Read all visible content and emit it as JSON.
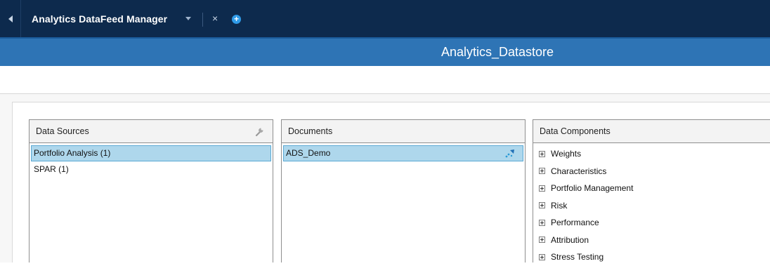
{
  "tab": {
    "title": "Analytics DataFeed Manager",
    "close_glyph": "×",
    "add_glyph": "+"
  },
  "header": {
    "title": "Analytics_Datastore"
  },
  "panels": {
    "data_sources": {
      "title": "Data Sources",
      "items": [
        "Portfolio Analysis (1)",
        "SPAR (1)"
      ],
      "selected_index": 0
    },
    "documents": {
      "title": "Documents",
      "items": [
        "ADS_Demo"
      ],
      "selected_index": 0
    },
    "data_components": {
      "title": "Data Components",
      "items": [
        "Weights",
        "Characteristics",
        "Portfolio Management",
        "Risk",
        "Performance",
        "Attribution",
        "Stress Testing"
      ]
    }
  },
  "colors": {
    "tabbar_bg": "#0d2a4d",
    "title_band_bg": "#2e74b5",
    "selection_bg": "#aed7ec",
    "selection_border": "#5ba9d4",
    "add_button": "#2f9be8"
  },
  "icons": {
    "back": "back-arrow-icon",
    "dropdown": "chevron-down-icon",
    "close": "close-icon",
    "add": "add-tab-icon",
    "settings": "wrench-icon",
    "document_link": "document-link-icon",
    "expand": "plus-square-icon"
  }
}
